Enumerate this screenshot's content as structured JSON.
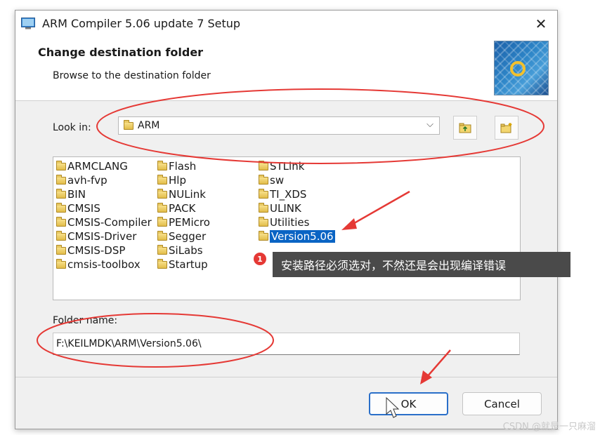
{
  "window": {
    "title": "ARM Compiler 5.06 update 7 Setup",
    "close_glyph": "✕"
  },
  "header": {
    "title": "Change destination folder",
    "subtitle": "Browse to the destination folder"
  },
  "lookin": {
    "label": "Look in:",
    "value": "ARM"
  },
  "folders": {
    "col1": [
      "ARMCLANG",
      "avh-fvp",
      "BIN",
      "CMSIS",
      "CMSIS-Compiler",
      "CMSIS-Driver",
      "CMSIS-DSP",
      "cmsis-toolbox"
    ],
    "col2": [
      "Flash",
      "Hlp",
      "NULink",
      "PACK",
      "PEMicro",
      "Segger",
      "SiLabs",
      "Startup"
    ],
    "col3": [
      "STLink",
      "sw",
      "TI_XDS",
      "ULINK",
      "Utilities",
      "Version5.06"
    ],
    "selected": "Version5.06"
  },
  "folder_name": {
    "label": "Folder name:",
    "value": "F:\\KEILMDK\\ARM\\Version5.06\\"
  },
  "buttons": {
    "ok": "OK",
    "cancel": "Cancel"
  },
  "annotation": {
    "badge": "1",
    "note": "安装路径必须选对，不然还是会出现编译错误"
  },
  "watermark": "CSDN @就是一只麻溜",
  "colors": {
    "selection": "#0a64c4",
    "annotation_red": "#e53935",
    "tooltip_bg": "#4a4a4a"
  },
  "icons": [
    "app-icon",
    "close-icon",
    "folder-icon",
    "up-folder-icon",
    "new-folder-icon",
    "logo-image"
  ]
}
